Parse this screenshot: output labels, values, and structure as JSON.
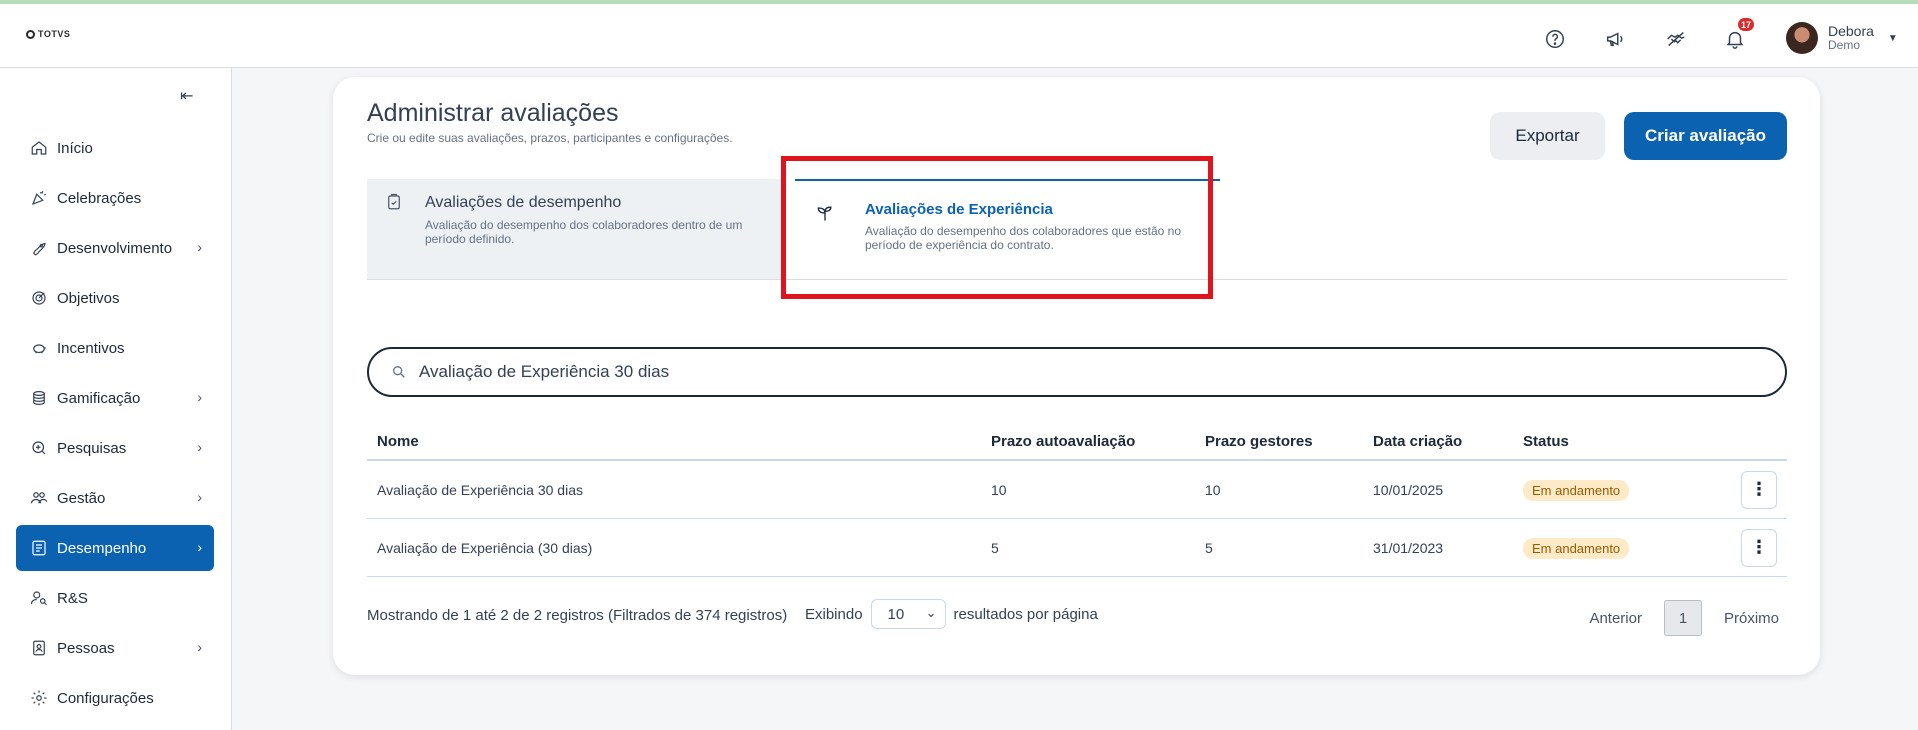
{
  "header": {
    "logo_text": "TOTVS",
    "notifications_count": "17",
    "user": {
      "name": "Debora",
      "subtitle": "Demo"
    }
  },
  "sidebar": {
    "collapse_label": "⇤",
    "items": [
      {
        "label": "Início",
        "icon": "home-icon",
        "has_children": false,
        "active": false
      },
      {
        "label": "Celebrações",
        "icon": "party-icon",
        "has_children": false,
        "active": false
      },
      {
        "label": "Desenvolvimento",
        "icon": "rocket-icon",
        "has_children": true,
        "active": false
      },
      {
        "label": "Objetivos",
        "icon": "target-icon",
        "has_children": false,
        "active": false
      },
      {
        "label": "Incentivos",
        "icon": "piggy-icon",
        "has_children": false,
        "active": false
      },
      {
        "label": "Gamificação",
        "icon": "coins-icon",
        "has_children": true,
        "active": false
      },
      {
        "label": "Pesquisas",
        "icon": "search-doc-icon",
        "has_children": true,
        "active": false
      },
      {
        "label": "Gestão",
        "icon": "team-icon",
        "has_children": true,
        "active": false
      },
      {
        "label": "Desempenho",
        "icon": "checklist-icon",
        "has_children": true,
        "active": true
      },
      {
        "label": "R&S",
        "icon": "user-search-icon",
        "has_children": false,
        "active": false
      },
      {
        "label": "Pessoas",
        "icon": "badge-icon",
        "has_children": true,
        "active": false
      },
      {
        "label": "Configurações",
        "icon": "gear-icon",
        "has_children": false,
        "active": false
      }
    ]
  },
  "page": {
    "title": "Administrar avaliações",
    "subtitle": "Crie ou edite suas avaliações, prazos, participantes e configurações.",
    "export_label": "Exportar",
    "create_label": "Criar avaliação"
  },
  "tabs": [
    {
      "title": "Avaliações de desempenho",
      "description": "Avaliação do desempenho dos colaboradores dentro de um período definido."
    },
    {
      "title": "Avaliações de Experiência",
      "description": "Avaliação do desempenho dos colaboradores que estão no período de experiência do contrato."
    }
  ],
  "search": {
    "value": "Avaliação de Experiência 30 dias"
  },
  "table": {
    "headers": [
      "Nome",
      "Prazo autoavaliação",
      "Prazo gestores",
      "Data criação",
      "Status"
    ],
    "rows": [
      {
        "nome": "Avaliação de Experiência 30 dias",
        "prazo_auto": "10",
        "prazo_gestores": "10",
        "data": "10/01/2025",
        "status": "Em andamento"
      },
      {
        "nome": "Avaliação de Experiência (30 dias)",
        "prazo_auto": "5",
        "prazo_gestores": "5",
        "data": "31/01/2023",
        "status": "Em andamento"
      }
    ],
    "kebab_label": "⋮"
  },
  "footer": {
    "showing": "Mostrando de 1 até 2 de 2 registros (Filtrados de 374 registros)",
    "exibindo": "Exibindo",
    "per_page_value": "10",
    "per_page_suffix": "resultados por página",
    "prev": "Anterior",
    "page": "1",
    "next": "Próximo"
  },
  "colors": {
    "accent": "#0b62b1",
    "highlight": "#e0141c",
    "status_bg": "#fdebc8"
  }
}
